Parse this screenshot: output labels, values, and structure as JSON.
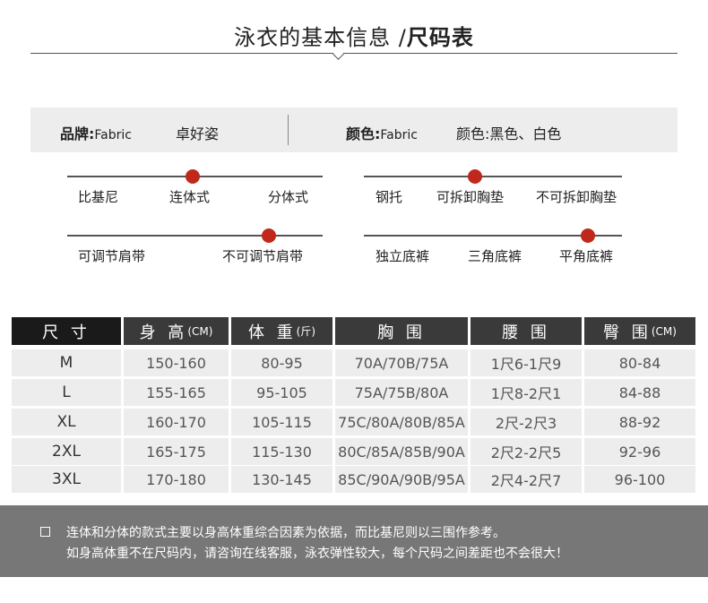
{
  "title": {
    "regular": "泳衣的基本信息 /",
    "bold": "尺码表"
  },
  "info": {
    "brand_label": "品牌:",
    "brand_value": "Fabric",
    "style_value": "卓好姿",
    "color_label": "颜色:",
    "color_value": "Fabric",
    "color2_label": "颜色:",
    "color2_value": "黑色、白色"
  },
  "options": {
    "group1": [
      "比基尼",
      "连体式",
      "分体式"
    ],
    "group2": [
      "钢托",
      "可拆卸胸垫",
      "不可拆卸胸垫"
    ],
    "group3": [
      "可调节肩带",
      "不可调节肩带"
    ],
    "group4": [
      "独立底裤",
      "三角底裤",
      "平角底裤"
    ],
    "selected": {
      "group1": "连体式",
      "group2": "可拆卸胸垫",
      "group3": "不可调节肩带",
      "group4": "平角底裤"
    }
  },
  "table": {
    "headers": [
      {
        "label": "尺 寸",
        "unit": ""
      },
      {
        "label": "身 高",
        "unit": "(CM)"
      },
      {
        "label": "体 重",
        "unit": "(斤)"
      },
      {
        "label": "胸 围",
        "unit": ""
      },
      {
        "label": "腰 围",
        "unit": ""
      },
      {
        "label": "臀 围",
        "unit": "(CM)"
      }
    ],
    "rows": [
      [
        "M",
        "150-160",
        "80-95",
        "70A/70B/75A",
        "1尺6-1尺9",
        "80-84"
      ],
      [
        "L",
        "155-165",
        "95-105",
        "75A/75B/80A",
        "1尺8-2尺1",
        "84-88"
      ],
      [
        "XL",
        "160-170",
        "105-115",
        "75C/80A/80B/85A",
        "2尺-2尺3",
        "88-92"
      ],
      [
        "2XL",
        "165-175",
        "115-130",
        "80C/85A/85B/90A",
        "2尺2-2尺5",
        "92-96"
      ],
      [
        "3XL",
        "170-180",
        "130-145",
        "85C/90A/90B/95A",
        "2尺4-2尺7",
        "96-100"
      ]
    ]
  },
  "footer": {
    "line1": "连体和分体的款式主要以身高体重综合因素为依据，而比基尼则以三围作参考。",
    "line2": "如身高体重不在尺码内，请咨询在线客服，泳衣弹性较大，每个尺码之间差距也不会很大！"
  },
  "colors": {
    "accent": "#c0281c",
    "header_bg": "#3a3a3a",
    "cell_bg": "#ededed",
    "footer_bg": "#777777"
  }
}
